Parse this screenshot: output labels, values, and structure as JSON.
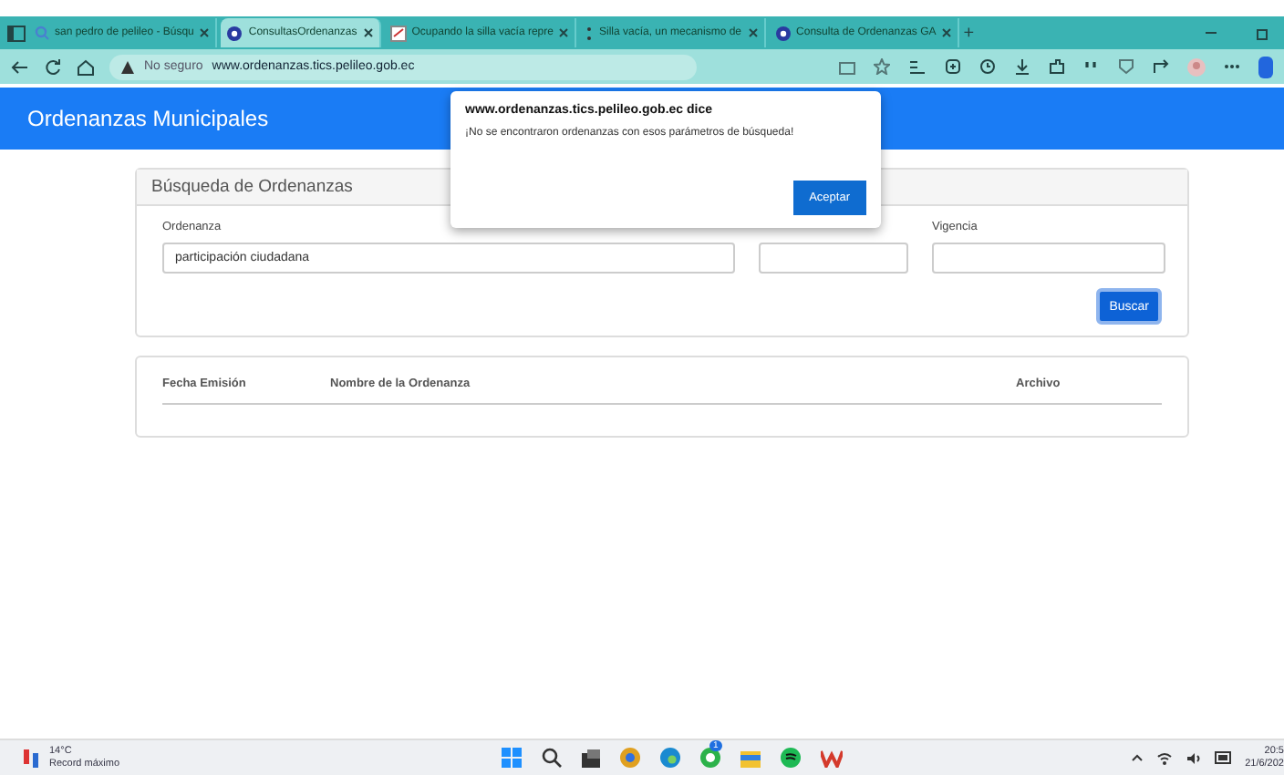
{
  "browser": {
    "tabs": [
      {
        "label": "san pedro de pelileo - Búsqu",
        "kind": "search",
        "selected": false
      },
      {
        "label": "ConsultasOrdenanzas",
        "kind": "site",
        "selected": true
      },
      {
        "label": "Ocupando la silla vacía repre",
        "kind": "doc",
        "selected": false
      },
      {
        "label": "Silla vacía, un mecanismo de",
        "kind": "dots",
        "selected": false
      },
      {
        "label": "Consulta de Ordenanzas GA",
        "kind": "site",
        "selected": false
      }
    ],
    "new_tab": "+",
    "security": "No seguro",
    "url": "www.ordenanzas.tics.pelileo.gob.ec"
  },
  "header": {
    "title": "Ordenanzas Municipales"
  },
  "search_card": {
    "title": "Búsqueda de Ordenanzas",
    "fields": [
      {
        "kind": "text",
        "label": "Ordenanza",
        "value": "participación ciudadana"
      },
      {
        "kind": "text"
      },
      {
        "kind": "text",
        "label": "Vigencia"
      }
    ],
    "button": "Buscar"
  },
  "results": {
    "columns": [
      "Fecha Emisión",
      "Nombre de la Ordenanza",
      "Archivo"
    ]
  },
  "dialog": {
    "title": "www.ordenanzas.tics.pelileo.gob.ec dice",
    "message": "¡No se encontraron ordenanzas con esos parámetros de búsqueda!",
    "button": "Aceptar"
  },
  "taskbar": {
    "temperature": "14°C",
    "weather": "Record máximo",
    "whatsapp_badge": "1",
    "time": "20:5",
    "date": "21/6/202"
  }
}
